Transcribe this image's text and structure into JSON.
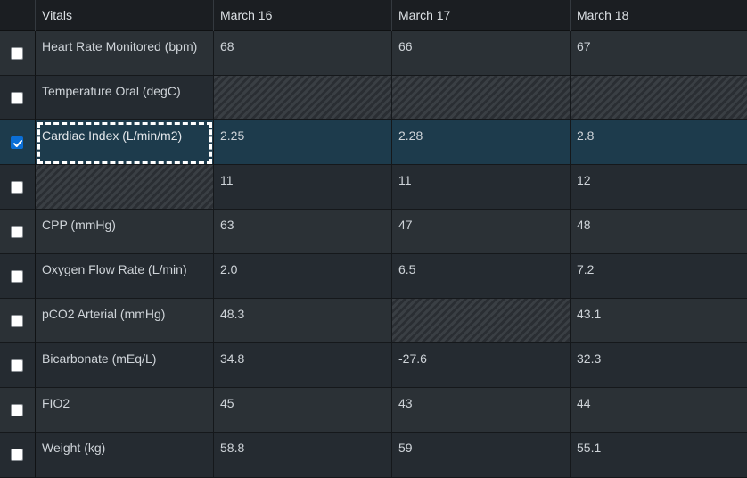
{
  "header": {
    "col1": "Vitals",
    "col2": "March 16",
    "col3": "March 17",
    "col4": "March 18"
  },
  "rows": [
    {
      "checked": false,
      "label": "Heart Rate Monitored (bpm)",
      "v1": "68",
      "v2": "66",
      "v3": "67"
    },
    {
      "checked": false,
      "label": "Temperature Oral (degC)",
      "v1": "",
      "v2": "",
      "v3": ""
    },
    {
      "checked": true,
      "label": "Cardiac Index (L/min/m2)",
      "v1": "2.25",
      "v2": "2.28",
      "v3": "2.8"
    },
    {
      "checked": false,
      "label": "",
      "v1": "11",
      "v2": "11",
      "v3": "12"
    },
    {
      "checked": false,
      "label": "CPP (mmHg)",
      "v1": "63",
      "v2": "47",
      "v3": "48"
    },
    {
      "checked": false,
      "label": "Oxygen Flow Rate (L/min)",
      "v1": "2.0",
      "v2": "6.5",
      "v3": "7.2"
    },
    {
      "checked": false,
      "label": "pCO2 Arterial (mmHg)",
      "v1": "48.3",
      "v2": "",
      "v3": "43.1"
    },
    {
      "checked": false,
      "label": "Bicarbonate (mEq/L)",
      "v1": "34.8",
      "v2": "-27.6",
      "v3": "32.3"
    },
    {
      "checked": false,
      "label": "FIO2",
      "v1": "45",
      "v2": "43",
      "v3": "44"
    },
    {
      "checked": false,
      "label": "Weight (kg)",
      "v1": "58.8",
      "v2": "59",
      "v3": "55.1"
    }
  ],
  "colors": {
    "background": "#22272c",
    "header_bg": "#1b1e22",
    "selected_row": "#1d3b4c",
    "checkbox_checked": "#0b6fd6"
  },
  "icons": {
    "checkbox_checked": "checkmark-icon"
  }
}
